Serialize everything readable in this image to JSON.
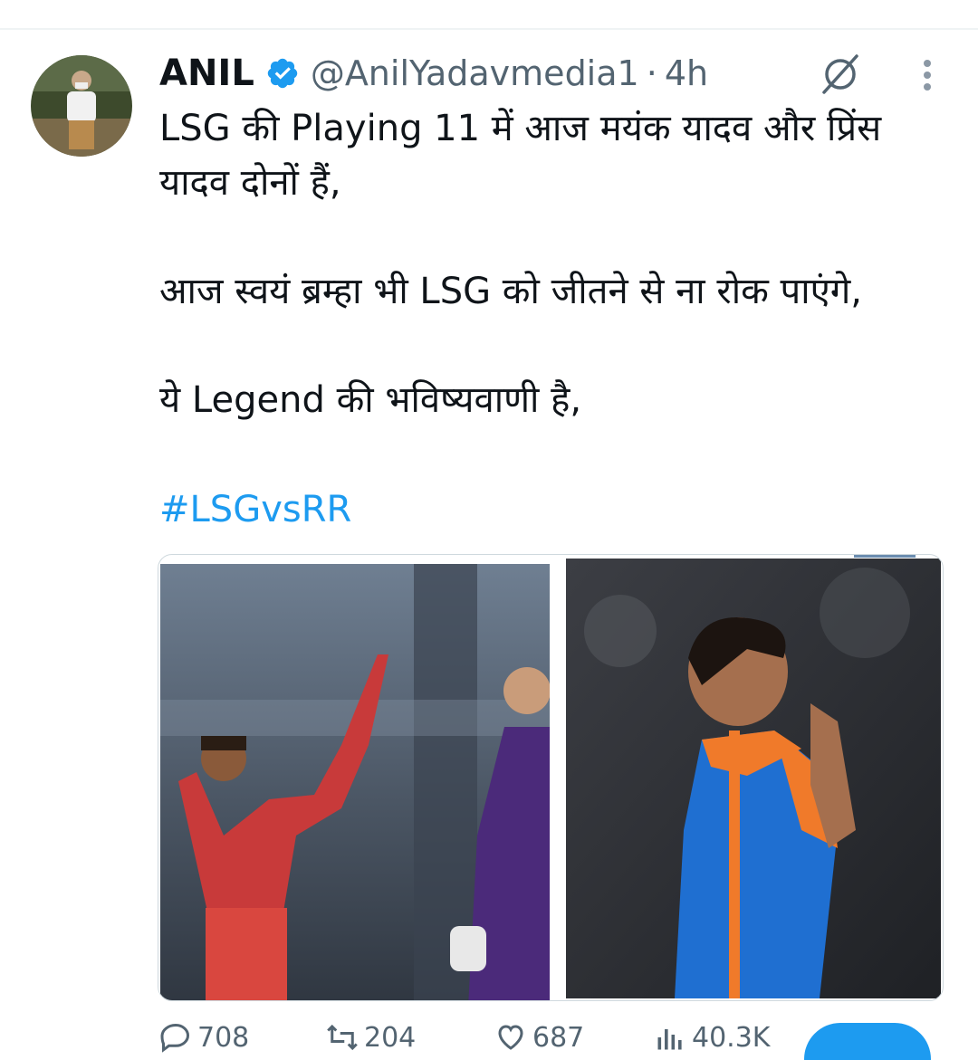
{
  "tweet": {
    "author": {
      "display_name": "ANIL",
      "handle": "@AnilYadavmedia1",
      "timestamp": "4h",
      "separator": "·"
    },
    "text_paragraphs": [
      "LSG की Playing 11 में आज मयंक यादव और प्रिंस यादव दोनों हैं,",
      "आज स्वयं ब्रम्हा भी LSG को जीतने से ना रोक पाएंगे,",
      "ये Legend की भविष्यवाणी है,"
    ],
    "hashtag": "#LSGvsRR",
    "stats": {
      "replies": "708",
      "reposts": "204",
      "likes": "687",
      "views": "40.3K"
    }
  },
  "icons": {
    "verified": "verified-badge-icon",
    "grok": "grok-icon",
    "more": "more-options-icon",
    "reply": "reply-icon",
    "repost": "repost-icon",
    "like": "heart-icon",
    "views": "views-icon"
  },
  "colors": {
    "accent": "#1d9bf0",
    "secondary_text": "#536471",
    "primary_text": "#0f1419"
  }
}
